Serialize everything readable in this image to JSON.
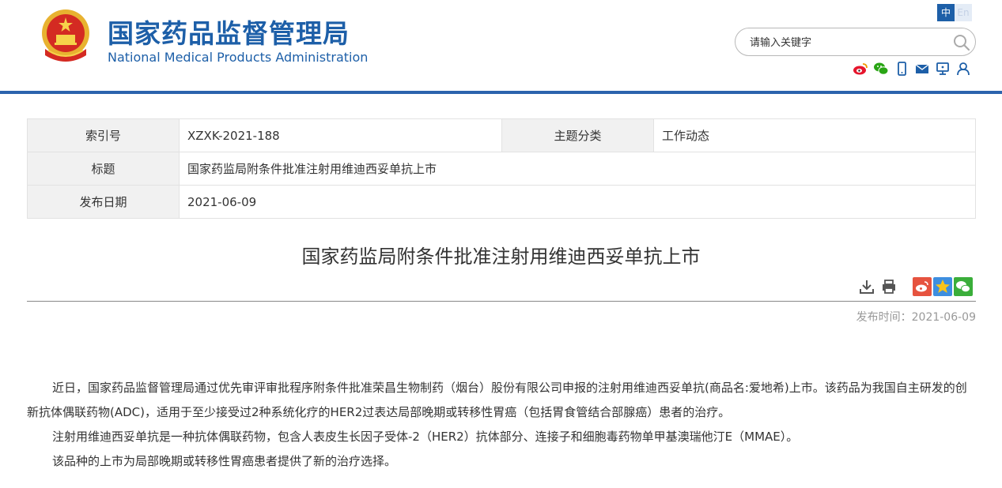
{
  "header": {
    "title_cn": "国家药品监督管理局",
    "title_en": "National Medical Products Administration",
    "lang": {
      "cn": "中",
      "en": "En"
    },
    "search_placeholder": "请输入关键字",
    "icons": [
      "weibo-icon",
      "wechat-icon",
      "mobile-icon",
      "mail-icon",
      "monitor-icon",
      "user-icon"
    ],
    "colors": {
      "brand": "#1d5fa8",
      "rule": "#2b63ad"
    }
  },
  "info": {
    "index_label": "索引号",
    "index_value": "XZXK-2021-188",
    "category_label": "主题分类",
    "category_value": "工作动态",
    "title_label": "标题",
    "title_value": "国家药监局附条件批准注射用维迪西妥单抗上市",
    "date_label": "发布日期",
    "date_value": "2021-06-09"
  },
  "article": {
    "title": "国家药监局附条件批准注射用维迪西妥单抗上市",
    "pub_label": "发布时间：",
    "pub_date": "2021-06-09",
    "paragraphs": [
      "近日，国家药品监督管理局通过优先审评审批程序附条件批准荣昌生物制药（烟台）股份有限公司申报的注射用维迪西妥单抗(商品名:爱地希)上市。该药品为我国自主研发的创新抗体偶联药物(ADC)，适用于至少接受过2种系统化疗的HER2过表达局部晚期或转移性胃癌（包括胃食管结合部腺癌）患者的治疗。",
      "注射用维迪西妥单抗是一种抗体偶联药物，包含人表皮生长因子受体-2（HER2）抗体部分、连接子和细胞毒药物单甲基澳瑞他汀E（MMAE）。",
      "该品种的上市为局部晚期或转移性胃癌患者提供了新的治疗选择。"
    ]
  }
}
